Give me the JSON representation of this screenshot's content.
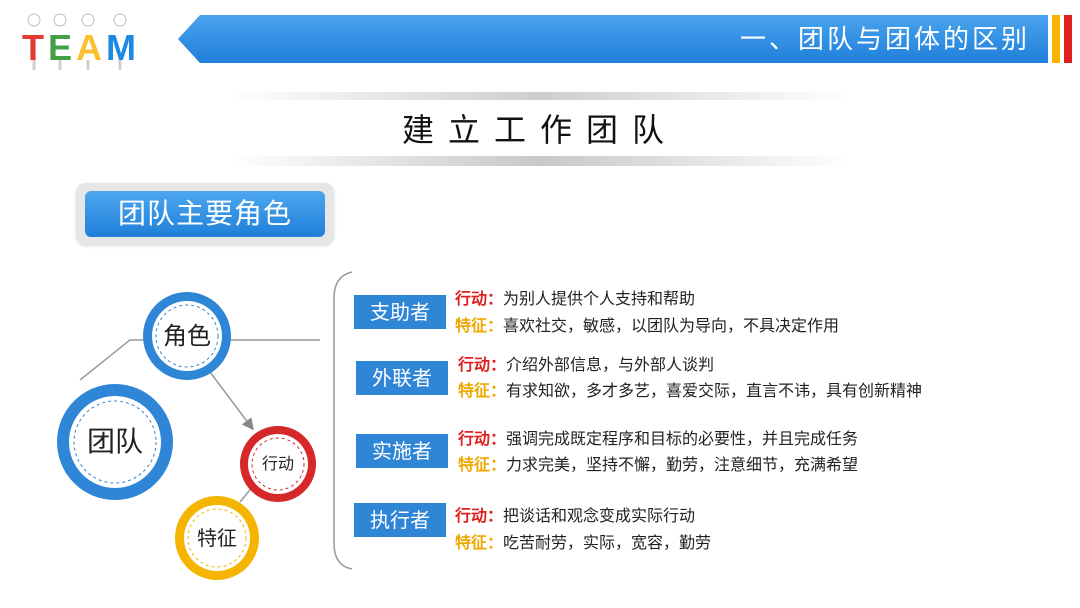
{
  "header": {
    "logo_text": "TEAM",
    "title": "一、团队与团体的区别"
  },
  "subtitle": "建立工作团队",
  "section_label": "团队主要角色",
  "diagram": {
    "team": "团队",
    "role": "角色",
    "action": "行动",
    "feature": "特征"
  },
  "labels": {
    "action": "行动：",
    "feature": "特征："
  },
  "roles": [
    {
      "name": "支助者",
      "action": "为别人提供个人支持和帮助",
      "feature": "喜欢社交，敏感，以团队为导向，不具决定作用"
    },
    {
      "name": "外联者",
      "action": "介绍外部信息，与外部人谈判",
      "feature": "有求知欲，多才多艺，喜爱交际，直言不讳，具有创新精神"
    },
    {
      "name": "实施者",
      "action": "强调完成既定程序和目标的必要性，并且完成任务",
      "feature": "力求完美，坚持不懈，勤劳，注意细节，充满希望"
    },
    {
      "name": "执行者",
      "action": "把谈话和观念变成实际行动",
      "feature": "吃苦耐劳，实际，宽容，勤劳"
    }
  ],
  "colors": {
    "blue": "#2f86d6",
    "red": "#e02020",
    "yellow": "#f4b400"
  }
}
